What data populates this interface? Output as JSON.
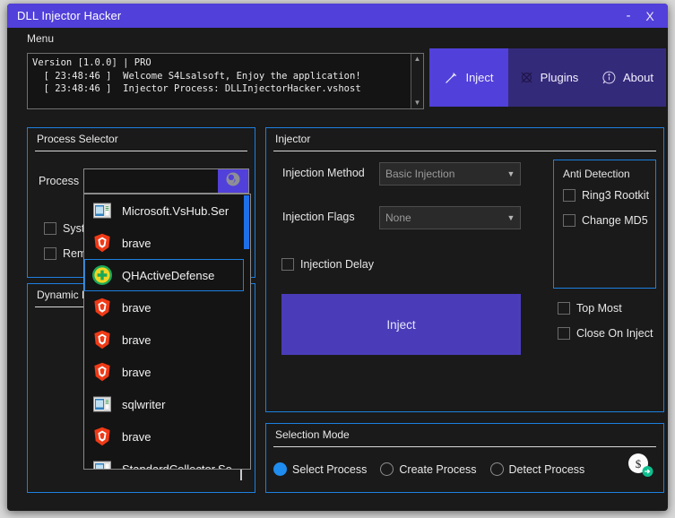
{
  "window": {
    "title": "DLL Injector Hacker",
    "minimize_label": "-",
    "close_label": "X",
    "accent_purple": "#5140d9",
    "panel_border_blue": "#1d7fe0",
    "background": "#1a1a1a"
  },
  "menubar": {
    "items": [
      {
        "label": "Menu"
      }
    ]
  },
  "log": {
    "line1": "Version [1.0.0] | PRO",
    "line2": "  [ 23:48:46 ]  Welcome S4Lsalsoft, Enjoy the application!",
    "line3": "  [ 23:48:46 ]  Injector Process: DLLInjectorHacker.vshost",
    "scroll_up": "▲",
    "scroll_down": "▼"
  },
  "tabs": [
    {
      "label": "Inject",
      "icon": "syringe-icon",
      "active": true
    },
    {
      "label": "Plugins",
      "icon": "puzzle-knot-icon",
      "active": false
    },
    {
      "label": "About",
      "icon": "info-circle-icon",
      "active": false
    }
  ],
  "process_selector": {
    "title": "Process Selector",
    "process_label": "Process",
    "process_value": "",
    "process_placeholder": "",
    "obs_button_icon": "obs-icon",
    "checkboxes": [
      {
        "label": "System Process",
        "clipped_label": "Syste",
        "checked": false
      },
      {
        "label": "Remote Process",
        "clipped_label": "Remo",
        "checked": false
      }
    ]
  },
  "process_dropdown": {
    "open": true,
    "scrollbar_color": "#1f6fe8",
    "items": [
      {
        "label": "Microsoft.VsHub.Ser",
        "icon": "window-app-icon",
        "selected": false
      },
      {
        "label": "brave",
        "icon": "brave-lion-icon",
        "selected": false
      },
      {
        "label": "QHActiveDefense",
        "icon": "qh-shield-icon",
        "selected": true
      },
      {
        "label": "brave",
        "icon": "brave-lion-icon",
        "selected": false
      },
      {
        "label": "brave",
        "icon": "brave-lion-icon",
        "selected": false
      },
      {
        "label": "brave",
        "icon": "brave-lion-icon",
        "selected": false
      },
      {
        "label": "sqlwriter",
        "icon": "window-app-icon",
        "selected": false
      },
      {
        "label": "brave",
        "icon": "brave-lion-icon",
        "selected": false
      },
      {
        "label": "StandardCollector.Se",
        "icon": "window-app-icon",
        "selected": false
      }
    ]
  },
  "dynamic": {
    "title": "Dynamic L",
    "full_title": "Dynamic Library"
  },
  "injector": {
    "title": "Injector",
    "method_label": "Injection Method",
    "method_value": "Basic Injection",
    "flags_label": "Injection Flags",
    "flags_value": "None",
    "delay_label": "Injection Delay",
    "delay_checked": false,
    "inject_button": "Inject",
    "anti_detection": {
      "title": "Anti Detection",
      "items": [
        {
          "label": "Ring3 Rootkit",
          "checked": false
        },
        {
          "label": "Change MD5",
          "checked": false
        }
      ]
    },
    "options": [
      {
        "label": "Top Most",
        "checked": false
      },
      {
        "label": "Close On Inject",
        "checked": false
      }
    ]
  },
  "selection_mode": {
    "title": "Selection Mode",
    "options": [
      {
        "label": "Select Process",
        "selected": true
      },
      {
        "label": "Create Process",
        "selected": false
      },
      {
        "label": "Detect Process",
        "selected": false
      }
    ],
    "donate_icon": "donate-dollar-icon"
  }
}
